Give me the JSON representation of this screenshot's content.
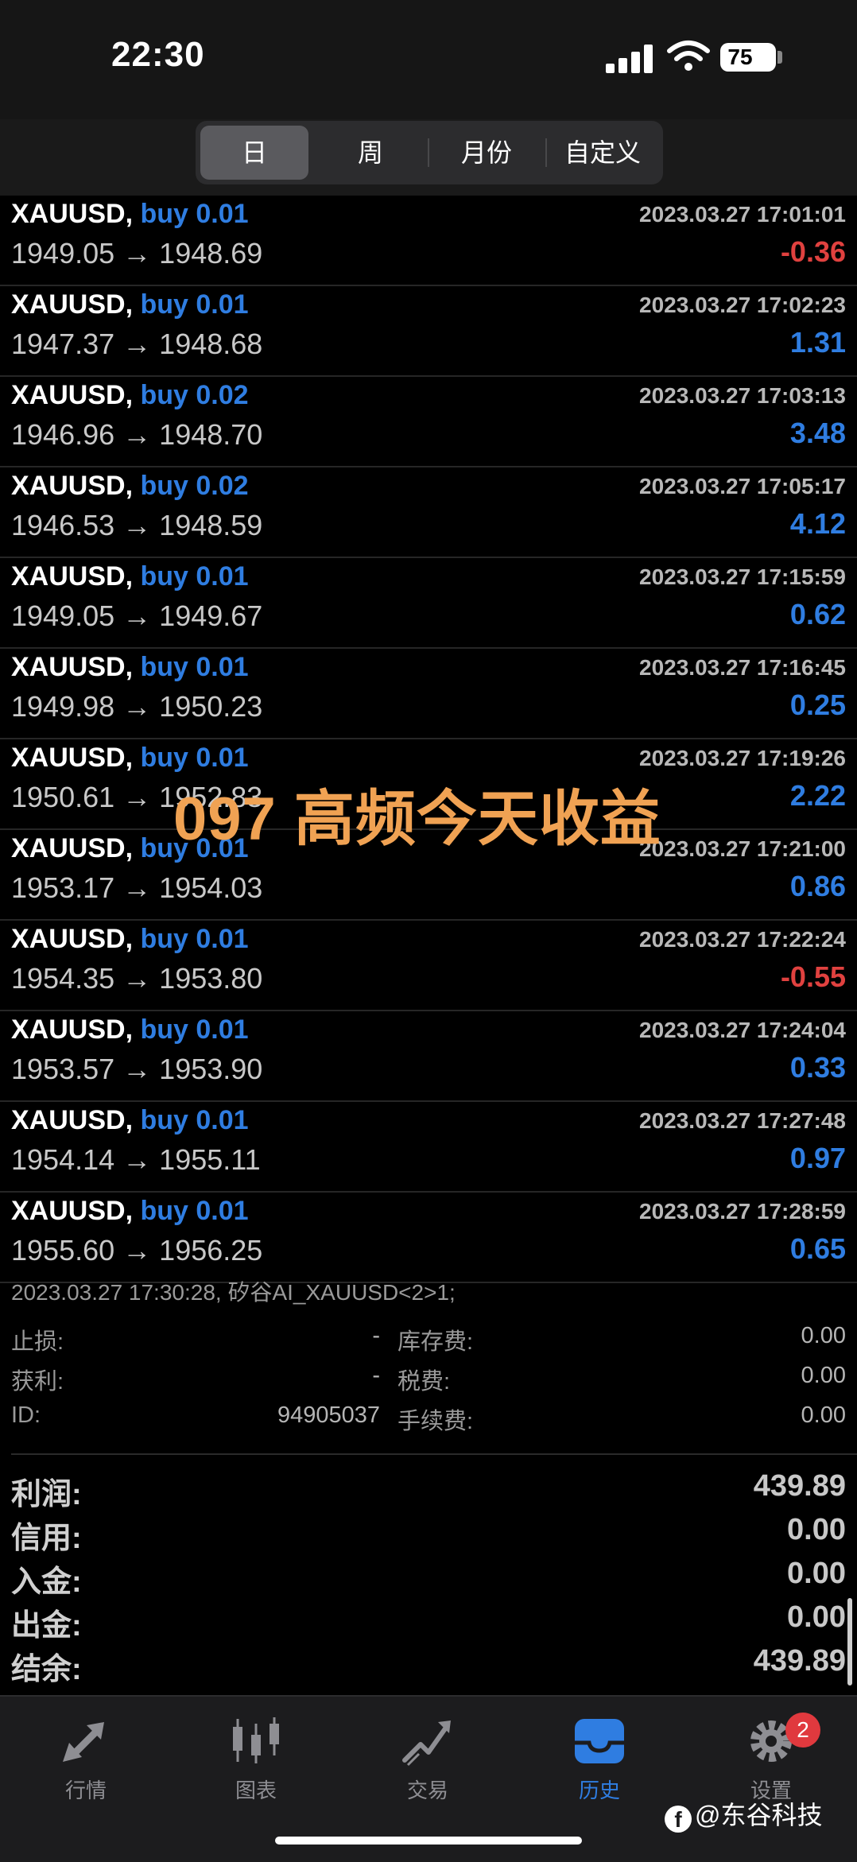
{
  "status": {
    "time": "22:30",
    "battery": "75"
  },
  "segments": [
    "日",
    "周",
    "月份",
    "自定义"
  ],
  "trades": [
    {
      "symbol": "XAUUSD,",
      "side": "buy 0.01",
      "datetime": "2023.03.27 17:01:01",
      "open": "1949.05",
      "close": "1948.69",
      "profit": "-0.36"
    },
    {
      "symbol": "XAUUSD,",
      "side": "buy 0.01",
      "datetime": "2023.03.27 17:02:23",
      "open": "1947.37",
      "close": "1948.68",
      "profit": "1.31"
    },
    {
      "symbol": "XAUUSD,",
      "side": "buy 0.02",
      "datetime": "2023.03.27 17:03:13",
      "open": "1946.96",
      "close": "1948.70",
      "profit": "3.48"
    },
    {
      "symbol": "XAUUSD,",
      "side": "buy 0.02",
      "datetime": "2023.03.27 17:05:17",
      "open": "1946.53",
      "close": "1948.59",
      "profit": "4.12"
    },
    {
      "symbol": "XAUUSD,",
      "side": "buy 0.01",
      "datetime": "2023.03.27 17:15:59",
      "open": "1949.05",
      "close": "1949.67",
      "profit": "0.62"
    },
    {
      "symbol": "XAUUSD,",
      "side": "buy 0.01",
      "datetime": "2023.03.27 17:16:45",
      "open": "1949.98",
      "close": "1950.23",
      "profit": "0.25"
    },
    {
      "symbol": "XAUUSD,",
      "side": "buy 0.01",
      "datetime": "2023.03.27 17:19:26",
      "open": "1950.61",
      "close": "1952.83",
      "profit": "2.22"
    },
    {
      "symbol": "XAUUSD,",
      "side": "buy 0.01",
      "datetime": "2023.03.27 17:21:00",
      "open": "1953.17",
      "close": "1954.03",
      "profit": "0.86"
    },
    {
      "symbol": "XAUUSD,",
      "side": "buy 0.01",
      "datetime": "2023.03.27 17:22:24",
      "open": "1954.35",
      "close": "1953.80",
      "profit": "-0.55"
    },
    {
      "symbol": "XAUUSD,",
      "side": "buy 0.01",
      "datetime": "2023.03.27 17:24:04",
      "open": "1953.57",
      "close": "1953.90",
      "profit": "0.33"
    },
    {
      "symbol": "XAUUSD,",
      "side": "buy 0.01",
      "datetime": "2023.03.27 17:27:48",
      "open": "1954.14",
      "close": "1955.11",
      "profit": "0.97"
    },
    {
      "symbol": "XAUUSD,",
      "side": "buy 0.01",
      "datetime": "2023.03.27 17:28:59",
      "open": "1955.60",
      "close": "1956.25",
      "profit": "0.65"
    }
  ],
  "arrow": "→",
  "watermark": "097 高频今天收益",
  "detail": {
    "header": "2023.03.27 17:30:28, 矽谷AI_XAUUSD<2>1;",
    "stop_loss_label": "止损:",
    "stop_loss_value": "-",
    "take_profit_label": "获利:",
    "take_profit_value": "-",
    "id_label": "ID:",
    "id_value": "94905037",
    "swap_label": "库存费:",
    "swap_value": "0.00",
    "tax_label": "税费:",
    "tax_value": "0.00",
    "commission_label": "手续费:",
    "commission_value": "0.00"
  },
  "summary": {
    "profit_label": "利润:",
    "profit_value": "439.89",
    "credit_label": "信用:",
    "credit_value": "0.00",
    "deposit_label": "入金:",
    "deposit_value": "0.00",
    "withdraw_label": "出金:",
    "withdraw_value": "0.00",
    "balance_label": "结余:",
    "balance_value": "439.89"
  },
  "tabs": [
    {
      "label": "行情",
      "icon": "quotes-arrows-icon"
    },
    {
      "label": "图表",
      "icon": "candlestick-chart-icon"
    },
    {
      "label": "交易",
      "icon": "trade-trend-icon"
    },
    {
      "label": "历史",
      "icon": "history-inbox-icon"
    },
    {
      "label": "设置",
      "icon": "settings-gear-icon"
    }
  ],
  "settings_badge": "2",
  "credit_text": "@东谷科技",
  "colors": {
    "accent_blue": "#2f7de1",
    "loss_red": "#e0413f",
    "watermark_orange": "#f0a253"
  }
}
